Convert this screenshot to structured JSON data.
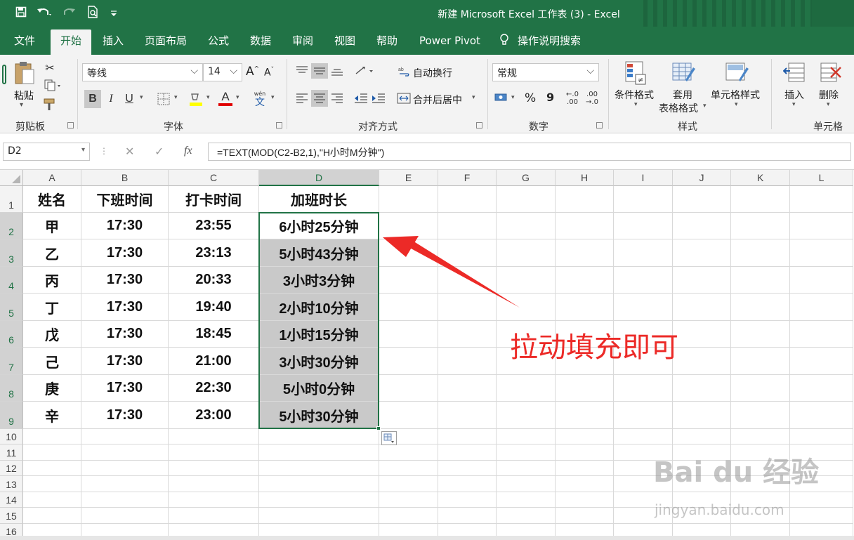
{
  "window": {
    "title": "新建 Microsoft Excel 工作表 (3)  -  Excel"
  },
  "qat": {
    "save_icon": "save-icon",
    "undo_icon": "undo-icon",
    "redo_icon": "redo-icon",
    "preview_icon": "print-preview-icon",
    "customize_icon": "customize-qat-icon"
  },
  "tabs": [
    {
      "label": "文件"
    },
    {
      "label": "开始"
    },
    {
      "label": "插入"
    },
    {
      "label": "页面布局"
    },
    {
      "label": "公式"
    },
    {
      "label": "数据"
    },
    {
      "label": "审阅"
    },
    {
      "label": "视图"
    },
    {
      "label": "帮助"
    },
    {
      "label": "Power Pivot"
    },
    {
      "label": "操作说明搜索"
    }
  ],
  "ribbon": {
    "clipboard": {
      "paste": "粘贴",
      "group": "剪贴板"
    },
    "font": {
      "name": "等线",
      "size": "14",
      "grow": "A",
      "shrink": "A",
      "bold": "B",
      "italic": "I",
      "underline": "U",
      "font_color_letter": "A",
      "phonetic_top": "wén",
      "phonetic_bottom": "文",
      "group": "字体"
    },
    "alignment": {
      "wrap": "自动换行",
      "merge": "合并后居中",
      "group": "对齐方式"
    },
    "number": {
      "format": "常规",
      "percent": "%",
      "comma": "9",
      "inc": ".00",
      "dec": ".00",
      "inc_small": "←.0",
      "dec_small": "→.0",
      "group": "数字"
    },
    "styles": {
      "conditional": "条件格式",
      "table_l1": "套用",
      "table_l2": "表格格式",
      "cell_styles": "单元格样式",
      "group": "样式"
    },
    "cells": {
      "insert": "插入",
      "delete": "删除",
      "group": "单元格"
    }
  },
  "formula_bar": {
    "name_box": "D2",
    "formula": "=TEXT(MOD(C2-B2,1),\"H小时M分钟\")"
  },
  "sheet": {
    "columns": [
      "A",
      "B",
      "C",
      "D",
      "E",
      "F",
      "G",
      "H",
      "I",
      "J",
      "K",
      "L"
    ],
    "rows": [
      "1",
      "2",
      "3",
      "4",
      "5",
      "6",
      "7",
      "8",
      "9",
      "10",
      "11",
      "12",
      "13",
      "14",
      "15",
      "16"
    ],
    "headers": [
      "姓名",
      "下班时间",
      "打卡时间",
      "加班时长"
    ],
    "data": [
      [
        "甲",
        "17:30",
        "23:55",
        "6小时25分钟"
      ],
      [
        "乙",
        "17:30",
        "23:13",
        "5小时43分钟"
      ],
      [
        "丙",
        "17:30",
        "20:33",
        "3小时3分钟"
      ],
      [
        "丁",
        "17:30",
        "19:40",
        "2小时10分钟"
      ],
      [
        "戊",
        "17:30",
        "18:45",
        "1小时15分钟"
      ],
      [
        "己",
        "17:30",
        "21:00",
        "3小时30分钟"
      ],
      [
        "庚",
        "17:30",
        "22:30",
        "5小时0分钟"
      ],
      [
        "辛",
        "17:30",
        "23:00",
        "5小时30分钟"
      ]
    ]
  },
  "annotation": {
    "text": "拉动填充即可",
    "color": "#ec2a27"
  },
  "watermark": {
    "main": "Bai du 经验",
    "sub": "jingyan.baidu.com"
  },
  "colors": {
    "accent": "#217346",
    "selection_fill": "#c9c9c9"
  }
}
